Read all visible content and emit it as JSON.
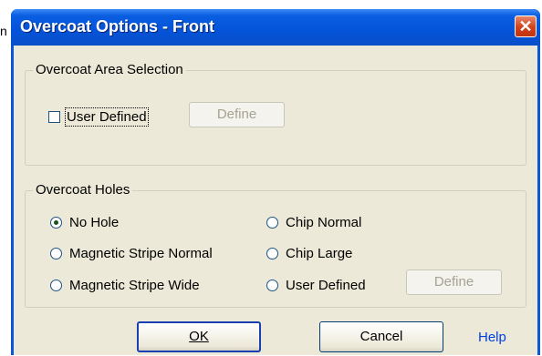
{
  "background_fragment": "n",
  "dialog": {
    "title": "Overcoat Options - Front",
    "close_glyph": "✕"
  },
  "area_selection": {
    "label": "Overcoat Area Selection",
    "user_defined_label": "User Defined",
    "user_defined_checked": false,
    "define_label": "Define"
  },
  "holes": {
    "label": "Overcoat Holes",
    "options": [
      {
        "label": "No Hole",
        "checked": true
      },
      {
        "label": "Magnetic Stripe Normal",
        "checked": false
      },
      {
        "label": "Magnetic Stripe Wide",
        "checked": false
      },
      {
        "label": "Chip Normal",
        "checked": false
      },
      {
        "label": "Chip Large",
        "checked": false
      },
      {
        "label": "User Defined",
        "checked": false
      }
    ],
    "define_label": "Define"
  },
  "buttons": {
    "ok": "OK",
    "cancel": "Cancel",
    "help": "Help"
  }
}
